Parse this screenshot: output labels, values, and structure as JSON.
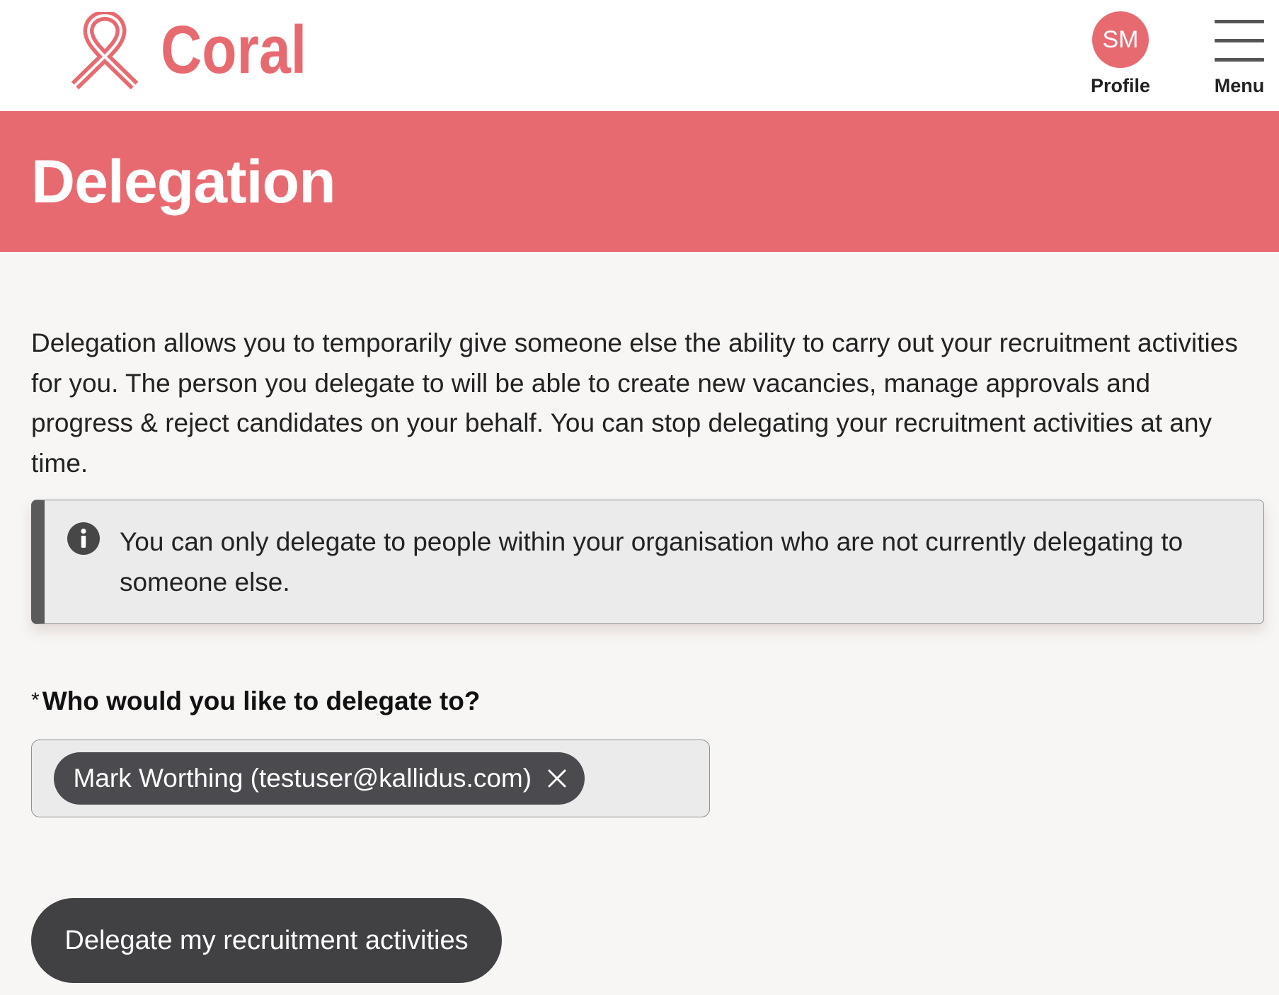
{
  "header": {
    "logo_text": "Coral",
    "logo_icon": "awareness-ribbon-icon",
    "profile": {
      "initials": "SM",
      "label": "Profile"
    },
    "menu": {
      "label": "Menu",
      "icon": "hamburger-menu-icon"
    }
  },
  "banner": {
    "title": "Delegation"
  },
  "intro": {
    "text": "Delegation allows you to temporarily give someone else the ability to carry out your recruitment activities for you. The person you delegate to will be able to create new vacancies, manage approvals and progress & reject candidates on your behalf. You can stop delegating your recruitment activities at any time."
  },
  "info_notice": {
    "icon": "info-icon",
    "text": "You can only delegate to people within your organisation who are not currently delegating to someone else."
  },
  "delegate_field": {
    "required_marker": "*",
    "label": "Who would you like to delegate to?",
    "selected": [
      {
        "text": "Mark Worthing (testuser@kallidus.com)",
        "remove_icon": "close-icon"
      }
    ]
  },
  "submit_button": {
    "label": "Delegate my recruitment activities"
  },
  "colors": {
    "brand": "#e86a71",
    "page_background": "#f7f6f4",
    "button": "#414043",
    "chip": "#4b4a4f",
    "notice_background": "#ebebeb",
    "notice_accent": "#5a5a5a"
  }
}
